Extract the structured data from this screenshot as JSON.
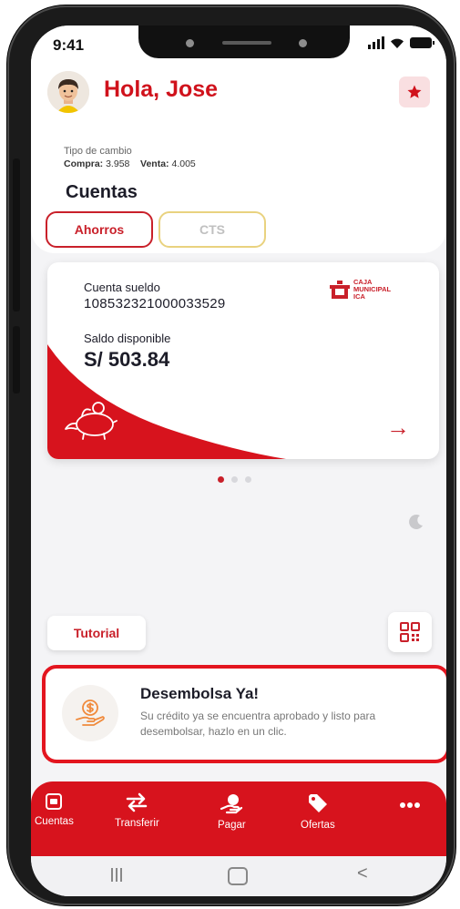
{
  "status_bar": {
    "time": "9:41"
  },
  "header": {
    "greeting": "Hola, Jose",
    "exchange_label": "Tipo de cambio",
    "buy_label": "Compra:",
    "buy_value": "3.958",
    "sell_label": "Venta:",
    "sell_value": "4.005",
    "section_title": "Cuentas",
    "tabs": [
      {
        "label": "Ahorros",
        "active": true
      },
      {
        "label": "CTS",
        "active": false
      }
    ]
  },
  "account_card": {
    "account_label": "Cuenta sueldo",
    "account_number": "108532321000033529",
    "balance_label": "Saldo disponible",
    "balance_value": "S/ 503.84",
    "bank_name_lines": [
      "CAJA",
      "MUNICIPAL",
      "ICA"
    ],
    "pager": {
      "count": 3,
      "active_index": 0
    }
  },
  "actions": {
    "tutorial_label": "Tutorial"
  },
  "promo": {
    "title": "Desembolsa Ya!",
    "text": "Su crédito ya se encuentra aprobado y listo para desembolsar, hazlo en un clic."
  },
  "bottom_nav": {
    "items": [
      {
        "label": "Cuentas",
        "icon": "wallet-icon"
      },
      {
        "label": "Transferir",
        "icon": "transfer-icon"
      },
      {
        "label": "Pagar",
        "icon": "pay-icon"
      },
      {
        "label": "Ofertas",
        "icon": "tag-icon"
      },
      {
        "label": "",
        "icon": "more-icon"
      }
    ]
  },
  "colors": {
    "brand_red": "#d7131d",
    "accent_yellow": "#e9d27f",
    "background": "#f4f4f6"
  }
}
